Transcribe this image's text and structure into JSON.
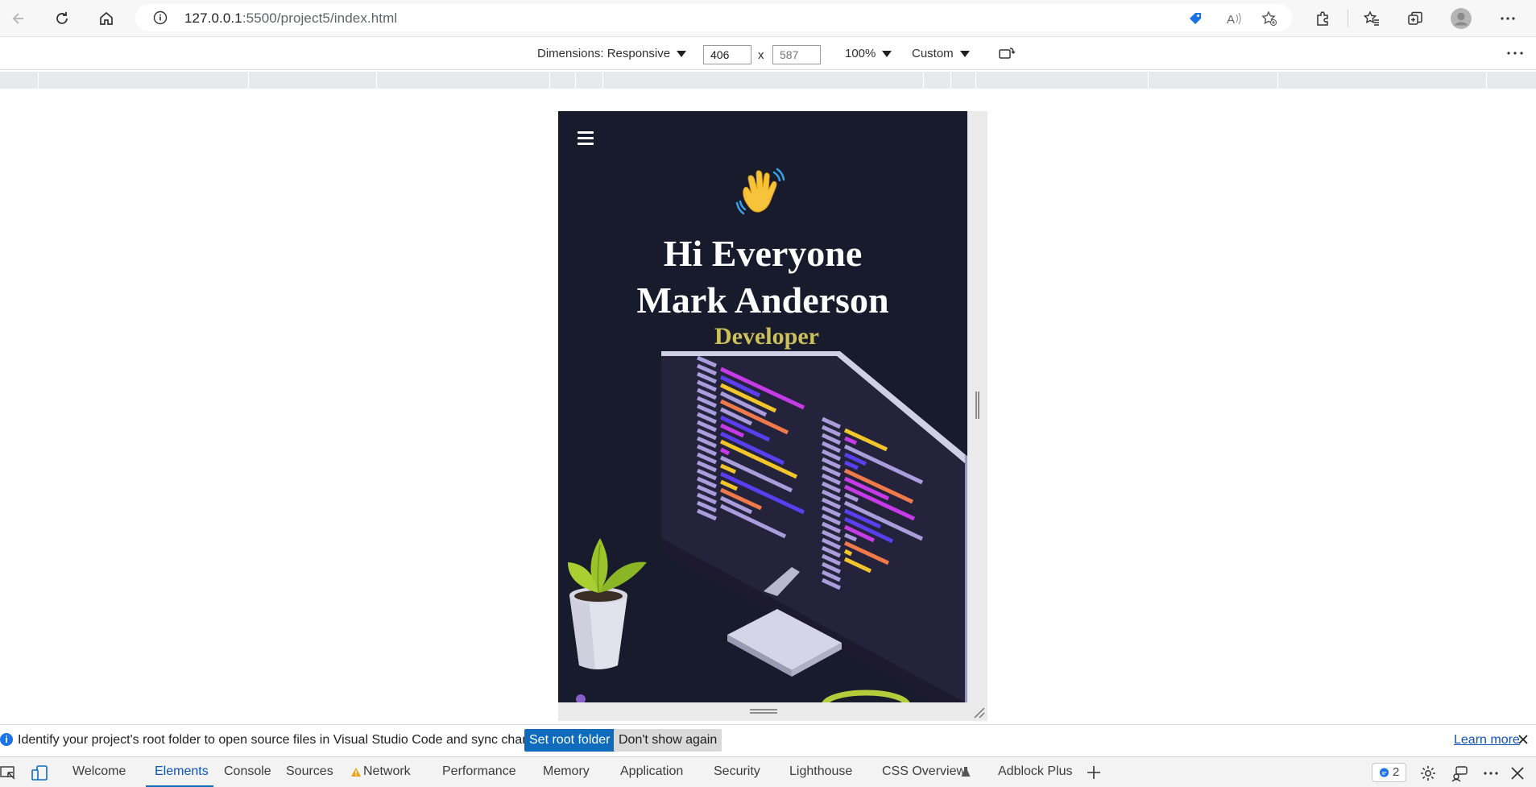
{
  "browser": {
    "url_host": "127.0.0.1",
    "url_path": ":5500/project5/index.html"
  },
  "device_toolbar": {
    "dimensions_label": "Dimensions: Responsive",
    "width": "406",
    "height_placeholder": "587",
    "times": "x",
    "zoom": "100%",
    "throttle": "Custom"
  },
  "site": {
    "greeting": "Hi Everyone",
    "name": "Mark Anderson",
    "role": "Developer"
  },
  "infobar": {
    "message": "Identify your project's root folder to open source files in Visual Studio Code and sync changes.",
    "set_root_label": "Set root folder",
    "dont_show_label": "Don't show again",
    "learn_more_label": "Learn more"
  },
  "devtools": {
    "tabs": [
      "Welcome",
      "Elements",
      "Console",
      "Sources",
      "Network",
      "Performance",
      "Memory",
      "Application",
      "Security",
      "Lighthouse",
      "CSS Overview",
      "Adblock Plus"
    ],
    "active_tab": "Elements",
    "issues_count": "2"
  },
  "colors": {
    "page_bg": "#171b2c",
    "role_text": "#cdc05a",
    "primary_button": "#0f6cbd"
  }
}
